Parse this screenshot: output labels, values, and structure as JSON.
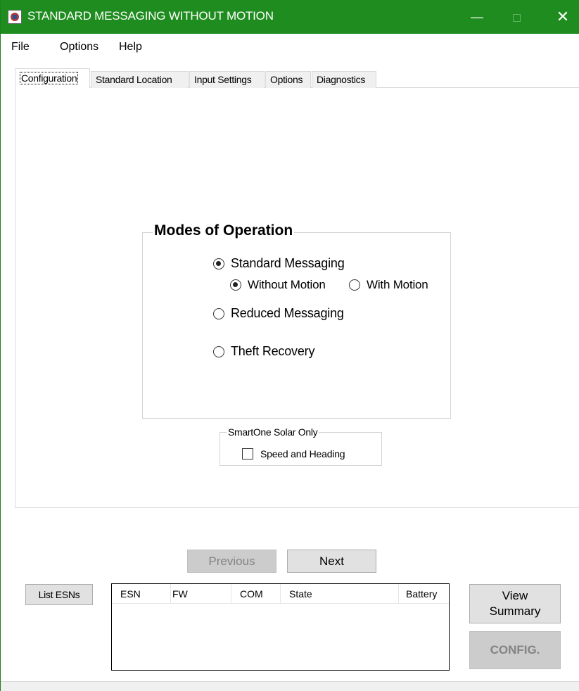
{
  "window": {
    "title": "STANDARD MESSAGING WITHOUT MOTION",
    "minimize": "—",
    "close": "✕"
  },
  "menu": {
    "file": "File",
    "options": "Options",
    "help": "Help"
  },
  "tabs": [
    {
      "label": "Configuration",
      "active": true
    },
    {
      "label": "Standard Location",
      "active": false
    },
    {
      "label": "Input Settings",
      "active": false
    },
    {
      "label": "Options",
      "active": false
    },
    {
      "label": "Diagnostics",
      "active": false
    }
  ],
  "modes": {
    "title": "Modes of Operation",
    "standard": {
      "label": "Standard Messaging",
      "checked": true
    },
    "without_motion": {
      "label": "Without Motion",
      "checked": true
    },
    "with_motion": {
      "label": "With Motion",
      "checked": false
    },
    "reduced": {
      "label": "Reduced Messaging",
      "checked": false
    },
    "theft": {
      "label": "Theft Recovery",
      "checked": false
    }
  },
  "solar": {
    "title": "SmartOne Solar Only",
    "speed_heading": {
      "label": "Speed and Heading",
      "checked": false
    }
  },
  "buttons": {
    "previous": "Previous",
    "next": "Next",
    "list_esns": "List ESNs",
    "view_summary_1": "View",
    "view_summary_2": "Summary",
    "config": "CONFIG."
  },
  "list": {
    "columns": [
      "ESN",
      "FW",
      "COM",
      "State",
      "Battery"
    ],
    "rows": []
  },
  "colors": {
    "titlebar": "#1e8c1e",
    "disabled_button": "#cccccc"
  }
}
